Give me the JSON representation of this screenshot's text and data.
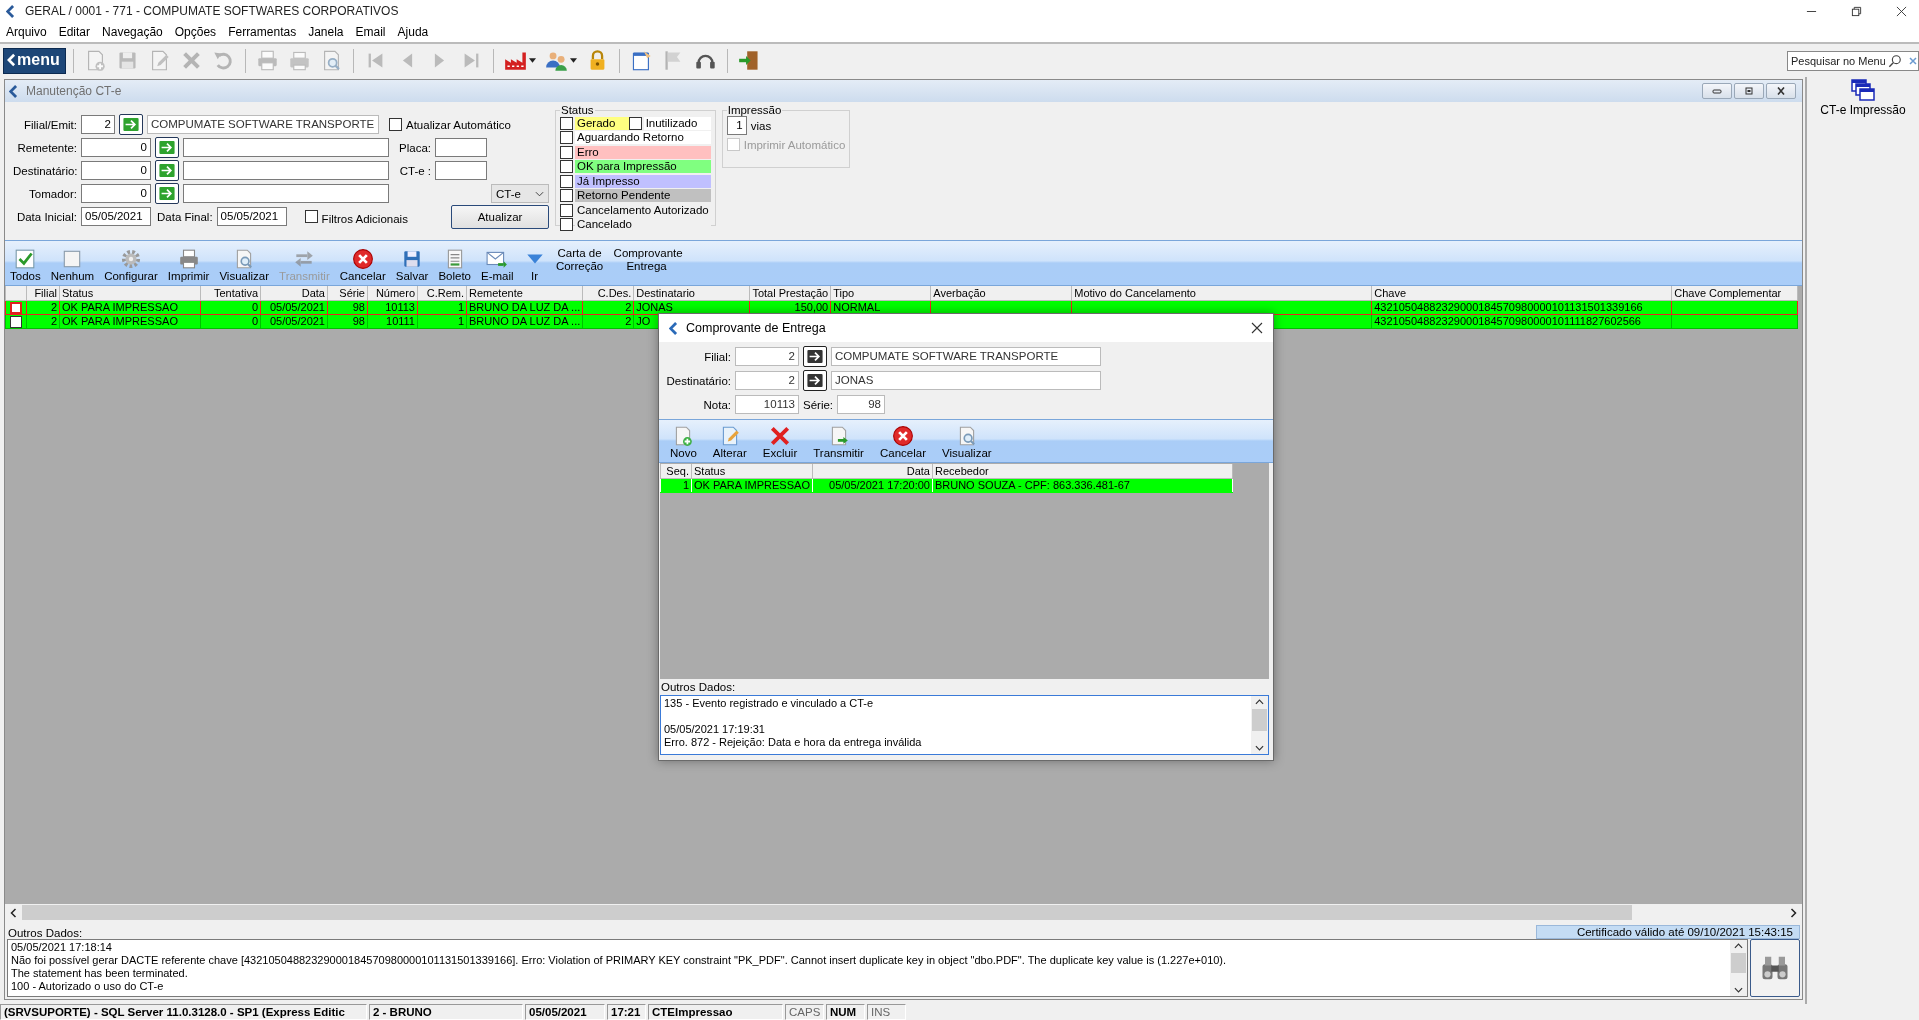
{
  "window": {
    "title": "GERAL / 0001 - 771 - COMPUMATE SOFTWARES CORPORATIVOS"
  },
  "menu": [
    "Arquivo",
    "Editar",
    "Navegação",
    "Opções",
    "Ferramentas",
    "Janela",
    "Email",
    "Ajuda"
  ],
  "toolbar": {
    "logo": "menu",
    "groups": [
      [
        {
          "kind": "newdoc",
          "disabled": true,
          "dropdown": false
        },
        {
          "kind": "save",
          "disabled": true,
          "dropdown": false
        },
        {
          "kind": "edit",
          "disabled": true,
          "dropdown": false
        },
        {
          "kind": "delete",
          "disabled": true,
          "dropdown": false
        },
        {
          "kind": "undo",
          "disabled": true,
          "dropdown": false
        }
      ],
      [
        {
          "kind": "printpreview",
          "disabled": true,
          "dropdown": false
        },
        {
          "kind": "print",
          "disabled": true,
          "dropdown": false
        },
        {
          "kind": "preview",
          "disabled": true,
          "dropdown": false
        }
      ],
      [
        {
          "kind": "first",
          "disabled": true,
          "dropdown": false
        },
        {
          "kind": "prev",
          "disabled": true,
          "dropdown": false
        },
        {
          "kind": "next",
          "disabled": true,
          "dropdown": false
        },
        {
          "kind": "last",
          "disabled": true,
          "dropdown": false
        }
      ],
      [
        {
          "kind": "factory",
          "disabled": false,
          "dropdown": true
        },
        {
          "kind": "users",
          "disabled": false,
          "dropdown": true
        },
        {
          "kind": "lock",
          "disabled": false,
          "dropdown": false
        }
      ],
      [
        {
          "kind": "note",
          "disabled": false,
          "dropdown": false
        },
        {
          "kind": "flag",
          "disabled": true,
          "dropdown": false
        },
        {
          "kind": "headset",
          "disabled": false,
          "dropdown": false
        }
      ],
      [
        {
          "kind": "exit",
          "disabled": false,
          "dropdown": false
        }
      ]
    ],
    "search": {
      "placeholder": "Pesquisar no Menu"
    }
  },
  "child_window": {
    "title": "Manutenção CT-e",
    "filters": {
      "filial": {
        "label": "Filial/Emit:",
        "value": "2",
        "name": "COMPUMATE SOFTWARE TRANSPORTE"
      },
      "auto_update": {
        "label": "Atualizar Automático",
        "checked": false
      },
      "remetente": {
        "label": "Remetente:",
        "value": "0"
      },
      "destinatario": {
        "label": "Destinatário:",
        "value": "0"
      },
      "tomador": {
        "label": "Tomador:",
        "value": "0"
      },
      "placa": {
        "label": "Placa:"
      },
      "cte": {
        "label": "CT-e :"
      },
      "doc_type": {
        "value": "CT-e"
      },
      "data_inicial": {
        "label": "Data Inicial:",
        "value": "05/05/2021"
      },
      "data_final": {
        "label": "Data Final:",
        "value": "05/05/2021"
      },
      "extra_filters": {
        "label": "Filtros Adicionais",
        "checked": false
      },
      "update_button": "Atualizar"
    },
    "status": {
      "title": "Status",
      "items": [
        {
          "label": "Gerado",
          "checked": false,
          "color": "#ffff80"
        },
        {
          "label": "Inutilizado",
          "checked": false,
          "color": "#ffffff"
        },
        {
          "label": "Aguardando Retorno",
          "checked": false,
          "color": "#ffffff"
        },
        {
          "label": "Erro",
          "checked": false,
          "color": "#ffc0c0"
        },
        {
          "label": "OK para Impressão",
          "checked": false,
          "color": "#80ff80"
        },
        {
          "label": "Já Impresso",
          "checked": false,
          "color": "#c0c0ff"
        },
        {
          "label": "Retorno Pendente",
          "checked": false,
          "color": "#c0c0c0"
        },
        {
          "label": "Cancelamento Autorizado",
          "checked": false,
          "color": "#f0f0f0"
        },
        {
          "label": "Cancelado",
          "checked": false,
          "color": "#f0f0f0"
        }
      ]
    },
    "printing": {
      "title": "Impressão",
      "copies": "1",
      "copies_label": "vias",
      "auto_print": {
        "label": "Imprimir Automático",
        "checked": false,
        "disabled": true
      }
    },
    "actions": [
      {
        "label": "Todos",
        "kind": "check",
        "disabled": false
      },
      {
        "label": "Nenhum",
        "kind": "blank",
        "disabled": false
      },
      {
        "label": "Configurar",
        "kind": "gear",
        "disabled": false
      },
      {
        "label": "Imprimir",
        "kind": "printer",
        "disabled": false
      },
      {
        "label": "Visualizar",
        "kind": "preview",
        "disabled": false
      },
      {
        "label": "Transmitir",
        "kind": "transmit",
        "disabled": true
      },
      {
        "label": "Cancelar",
        "kind": "cancel",
        "disabled": false
      },
      {
        "label": "Salvar",
        "kind": "saveb",
        "disabled": false
      },
      {
        "label": "Boleto",
        "kind": "boleto",
        "disabled": false
      },
      {
        "label": "E-mail",
        "kind": "email",
        "disabled": false
      },
      {
        "label": "Ir",
        "kind": "down",
        "disabled": false
      },
      {
        "label": "Carta de Correção",
        "kind": "text",
        "disabled": false
      },
      {
        "label": "Comprovante Entrega",
        "kind": "text",
        "disabled": false
      }
    ],
    "table": {
      "columns": [
        "Filial",
        "Status",
        "Tentativa",
        "Data",
        "Série",
        "Número",
        "C.Rem.",
        "Remetente",
        "C.Des.",
        "Destinatario",
        "Total Prestação",
        "Tipo",
        "Averbação",
        "Motivo do Cancelamento",
        "Chave",
        "Chave Complementar"
      ],
      "rows": [
        {
          "checked": false,
          "selected": true,
          "filial": "2",
          "status": "OK PARA IMPRESSAO",
          "tentativa": "0",
          "data": "05/05/2021",
          "serie": "98",
          "numero": "10113",
          "c_rem": "1",
          "remetente": "BRUNO DA LUZ DA ...",
          "c_des": "2",
          "destinatario": "JONAS",
          "total_prestacao": "150,00",
          "tipo": "NORMAL",
          "chave": "43210504882329000184570980000101131501339166"
        },
        {
          "checked": false,
          "selected": false,
          "filial": "2",
          "status": "OK PARA IMPRESSAO",
          "tentativa": "0",
          "data": "05/05/2021",
          "serie": "98",
          "numero": "10111",
          "c_rem": "1",
          "remetente": "BRUNO DA LUZ DA ...",
          "c_des": "2",
          "destinatario": "JO",
          "chave": "43210504882329000184570980000101111827602566"
        }
      ]
    },
    "details_label": "Outros Dados:",
    "certificate": "Certificado válido até 09/10/2021 15:43:15",
    "details": "05/05/2021 17:18:14\nNão foi possível gerar DACTE referente chave [43210504882329000184570980000101131501339166]. Erro: Violation of PRIMARY KEY constraint \"PK_PDF\". Cannot insert duplicate key in object \"dbo.PDF\". The duplicate key value is (1.227e+010).\nThe statement has been terminated.\n100 - Autorizado o uso do CT-e"
  },
  "shortcuts": [
    {
      "label": "CT-e Impressão"
    }
  ],
  "status_bar": {
    "panels": [
      "(SRVSUPORTE) - SQL Server 11.0.3128.0 - SP1 (Express Editic",
      "2 - BRUNO",
      "05/05/2021",
      "17:21",
      "CTEImpressao"
    ],
    "keys": [
      {
        "label": "CAPS",
        "on": false
      },
      {
        "label": "NUM",
        "on": true
      },
      {
        "label": "INS",
        "on": false
      }
    ]
  },
  "dialog": {
    "title": "Comprovante de Entrega",
    "filial": {
      "label": "Filial:",
      "value": "2",
      "name": "COMPUMATE SOFTWARE TRANSPORTE"
    },
    "destinatario": {
      "label": "Destinatário:",
      "value": "2",
      "name": "JONAS"
    },
    "nota": {
      "label": "Nota:",
      "value": "10113"
    },
    "serie": {
      "label": "Série:",
      "value": "98"
    },
    "actions": [
      {
        "label": "Novo",
        "kind": "newdocg",
        "disabled": false
      },
      {
        "label": "Alterar",
        "kind": "editc",
        "disabled": false
      },
      {
        "label": "Excluir",
        "kind": "deleter",
        "disabled": false
      },
      {
        "label": "Transmitir",
        "kind": "doctransmit",
        "disabled": false
      },
      {
        "label": "Cancelar",
        "kind": "cancel",
        "disabled": false
      },
      {
        "label": "Visualizar",
        "kind": "preview",
        "disabled": false
      }
    ],
    "table": {
      "columns": [
        "Seq.",
        "Status",
        "Data",
        "Recebedor"
      ],
      "rows": [
        {
          "seq": "1",
          "status": "OK PARA IMPRESSAO",
          "data": "05/05/2021 17:20:00",
          "recebedor": "BRUNO SOUZA - CPF: 863.336.481-67",
          "selected": true
        }
      ]
    },
    "details_label": "Outros Dados:",
    "details": "135 - Evento registrado e vinculado a CT-e\n\n05/05/2021 17:19:31\nErro. 872 - Rejeição: Data e hora da entrega inválida"
  }
}
